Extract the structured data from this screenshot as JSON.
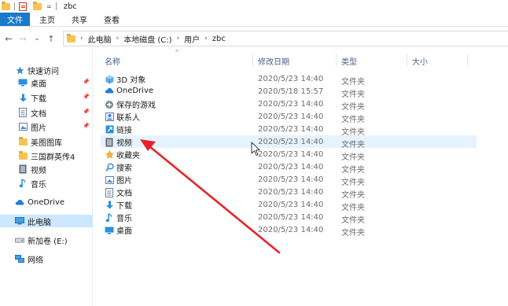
{
  "titlebar": {
    "title": "zbc",
    "qa_dropdown": "="
  },
  "ribbon": {
    "tabs": [
      "文件",
      "主页",
      "共享",
      "查看"
    ]
  },
  "nav": {
    "back": "←",
    "forward": "→",
    "recent": "⌄",
    "up": "↑",
    "breadcrumbs": [
      "此电脑",
      "本地磁盘 (C:)",
      "用户",
      "zbc"
    ],
    "separator": "›"
  },
  "sidebar": {
    "items": [
      {
        "label": "快速访问",
        "icon": "star-icon",
        "pinned": false
      },
      {
        "label": "桌面",
        "icon": "desktop-icon",
        "pinned": true
      },
      {
        "label": "下载",
        "icon": "download-icon",
        "pinned": true
      },
      {
        "label": "文档",
        "icon": "document-icon",
        "pinned": true
      },
      {
        "label": "图片",
        "icon": "picture-icon",
        "pinned": true
      },
      {
        "label": "美图图库",
        "icon": "folder-icon",
        "pinned": false
      },
      {
        "label": "三国群英传4",
        "icon": "folder-icon",
        "pinned": false
      },
      {
        "label": "视频",
        "icon": "video-icon",
        "pinned": false
      },
      {
        "label": "音乐",
        "icon": "music-icon",
        "pinned": false
      },
      {
        "label": "OneDrive",
        "icon": "cloud-icon",
        "pinned": false
      },
      {
        "label": "此电脑",
        "icon": "computer-icon",
        "pinned": false,
        "selected": true
      },
      {
        "label": "新加卷 (E:)",
        "icon": "drive-icon",
        "pinned": false
      },
      {
        "label": "网络",
        "icon": "network-icon",
        "pinned": false
      }
    ],
    "pin_glyph": "📌"
  },
  "columns": {
    "name": "名称",
    "date": "修改日期",
    "type": "类型",
    "size": "大小",
    "sort_glyph": "^"
  },
  "files": [
    {
      "name": "3D 对象",
      "date": "2020/5/23 14:40",
      "type": "文件夹",
      "icon": "3d-objects-icon"
    },
    {
      "name": "OneDrive",
      "date": "2020/5/18 15:57",
      "type": "文件夹",
      "icon": "cloud-icon"
    },
    {
      "name": "保存的游戏",
      "date": "2020/5/23 14:40",
      "type": "文件夹",
      "icon": "saved-games-icon"
    },
    {
      "name": "联系人",
      "date": "2020/5/23 14:40",
      "type": "文件夹",
      "icon": "contacts-icon"
    },
    {
      "name": "链接",
      "date": "2020/5/23 14:40",
      "type": "文件夹",
      "icon": "links-icon"
    },
    {
      "name": "视频",
      "date": "2020/5/23 14:40",
      "type": "文件夹",
      "icon": "video-icon",
      "hover": true
    },
    {
      "name": "收藏夹",
      "date": "2020/5/23 14:40",
      "type": "文件夹",
      "icon": "favorites-icon"
    },
    {
      "name": "搜索",
      "date": "2020/5/23 14:40",
      "type": "文件夹",
      "icon": "search-icon"
    },
    {
      "name": "图片",
      "date": "2020/5/23 14:40",
      "type": "文件夹",
      "icon": "picture-icon"
    },
    {
      "name": "文档",
      "date": "2020/5/23 14:40",
      "type": "文件夹",
      "icon": "document-icon"
    },
    {
      "name": "下载",
      "date": "2020/5/23 14:40",
      "type": "文件夹",
      "icon": "download-icon"
    },
    {
      "name": "音乐",
      "date": "2020/5/23 14:40",
      "type": "文件夹",
      "icon": "music-icon"
    },
    {
      "name": "桌面",
      "date": "2020/5/23 14:40",
      "type": "文件夹",
      "icon": "desktop-icon"
    }
  ],
  "colors": {
    "accent": "#1979ca",
    "selection": "#cce8ff",
    "hover": "#e5f3ff",
    "annotation_arrow": "#e8232a"
  }
}
